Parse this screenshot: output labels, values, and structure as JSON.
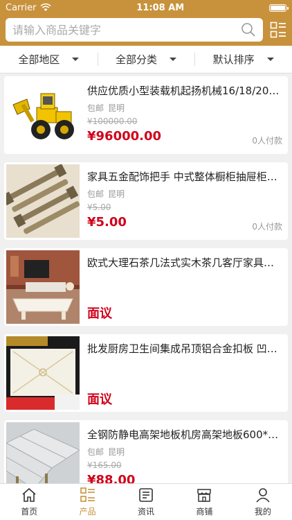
{
  "status": {
    "carrier": "Carrier",
    "time": "11:08 AM"
  },
  "search": {
    "placeholder": "请输入商品关键字"
  },
  "filters": [
    {
      "label": "全部地区"
    },
    {
      "label": "全部分类"
    },
    {
      "label": "默认排序"
    }
  ],
  "products": [
    {
      "title": "供应优质小型装载机起扬机械16/18/20/2…",
      "shipping": "包邮",
      "city": "昆明",
      "old_price": "¥100000.00",
      "price": "¥96000.00",
      "sold": "0人付款"
    },
    {
      "title": "家具五金配饰把手 中式整体橱柜抽屉柜…",
      "shipping": "包邮",
      "city": "昆明",
      "old_price": "¥5.00",
      "price": "¥5.00",
      "sold": "0人付款"
    },
    {
      "title": "欧式大理石茶几法式实木茶几客厅家具法…",
      "negotiate": "面议"
    },
    {
      "title": "批发厨房卫生间集成吊顶铝合金扣板 凹…",
      "negotiate": "面议"
    },
    {
      "title": "全钢防静电高架地板机房高架地板600*6…",
      "shipping": "包邮",
      "city": "昆明",
      "old_price": "¥165.00",
      "price": "¥88.00"
    }
  ],
  "tabs": [
    {
      "label": "首页"
    },
    {
      "label": "产品"
    },
    {
      "label": "资讯"
    },
    {
      "label": "商铺"
    },
    {
      "label": "我的"
    }
  ],
  "colors": {
    "brand": "#c8923c",
    "price": "#d0021b"
  }
}
